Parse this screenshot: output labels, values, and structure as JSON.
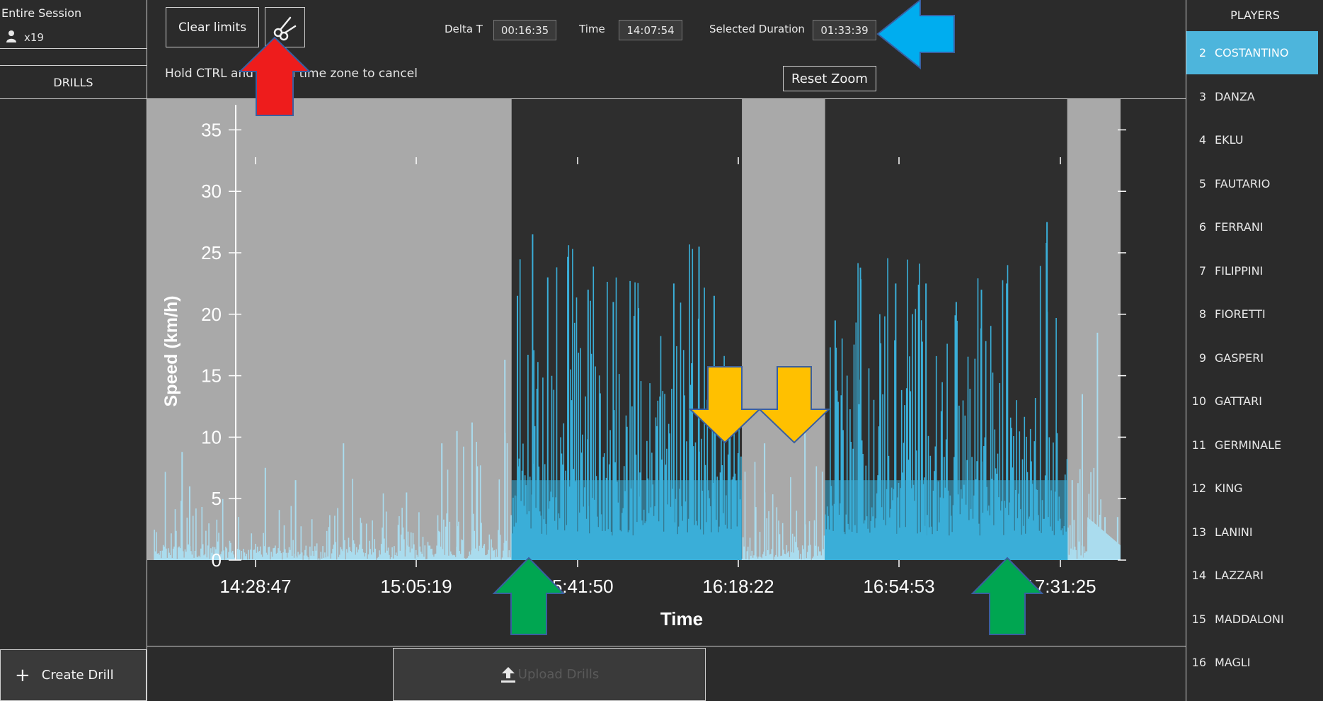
{
  "left_panel": {
    "session_title": "Entire Session",
    "player_count": "x19",
    "drills_header": "DRILLS",
    "create_drill_label": "Create Drill"
  },
  "toolbar": {
    "clear_limits_label": "Clear limits",
    "scissors_icon": "scissors-icon",
    "delta_t_label": "Delta T",
    "delta_t_value": "00:16:35",
    "time_label": "Time",
    "time_value": "14:07:54",
    "selected_duration_label": "Selected Duration",
    "selected_duration_value": "01:33:39",
    "hint": "Hold CTRL and click a time zone to cancel",
    "reset_zoom_label": "Reset Zoom"
  },
  "bottom": {
    "upload_drills_label": "Upload Drills",
    "upload_icon": "upload-icon"
  },
  "players_panel": {
    "header": "PLAYERS",
    "selected_number": "2",
    "items": [
      {
        "number": "2",
        "name": "COSTANTINO"
      },
      {
        "number": "3",
        "name": "DANZA"
      },
      {
        "number": "4",
        "name": "EKLU"
      },
      {
        "number": "5",
        "name": "FAUTARIO"
      },
      {
        "number": "6",
        "name": "FERRANI"
      },
      {
        "number": "7",
        "name": "FILIPPINI"
      },
      {
        "number": "8",
        "name": "FIORETTI"
      },
      {
        "number": "9",
        "name": "GASPERI"
      },
      {
        "number": "10",
        "name": "GATTARI"
      },
      {
        "number": "11",
        "name": "GERMINALE"
      },
      {
        "number": "12",
        "name": "KING"
      },
      {
        "number": "13",
        "name": "LANINI"
      },
      {
        "number": "14",
        "name": "LAZZARI"
      },
      {
        "number": "15",
        "name": "MADDALONI"
      },
      {
        "number": "16",
        "name": "MAGLI"
      }
    ]
  },
  "colors": {
    "background": "#2b2b2b",
    "selected_player": "#4db5dc",
    "zone_inactive": "#a9a9a9",
    "zone_active": "#2e2e2e",
    "speed_active": "#3aaed8",
    "speed_inactive": "#aadcee",
    "arrow_red": "#ee1c1c",
    "arrow_blue": "#00adef",
    "arrow_yellow": "#ffc000",
    "arrow_green": "#00a651"
  },
  "chart_data": {
    "type": "area",
    "xlabel": "Time",
    "ylabel": "Speed (km/h)",
    "ylim": [
      0,
      37.5
    ],
    "yticks": [
      0,
      5,
      10,
      15,
      20,
      25,
      30,
      35
    ],
    "x_time_range": [
      "14:24:35",
      "17:37:35"
    ],
    "xtick_labels": [
      "14:28:47",
      "15:05:19",
      "15:41:50",
      "16:18:22",
      "16:54:53",
      "17:31:25"
    ],
    "selected_zones": [
      {
        "start": "15:36:50",
        "end": "16:22:30"
      },
      {
        "start": "16:39:00",
        "end": "17:27:00"
      }
    ],
    "speed_peaks": [
      {
        "t": "14:31:30",
        "v": 8.8
      },
      {
        "t": "14:33:00",
        "v": 6.0
      },
      {
        "t": "14:48:00",
        "v": 7.5
      },
      {
        "t": "14:54:00",
        "v": 6.5
      },
      {
        "t": "15:03:30",
        "v": 9.5
      },
      {
        "t": "15:16:00",
        "v": 5.5
      },
      {
        "t": "15:23:00",
        "v": 9.5
      },
      {
        "t": "15:26:00",
        "v": 10.5
      },
      {
        "t": "15:29:00",
        "v": 11.2
      },
      {
        "t": "15:35:30",
        "v": 16.3
      },
      {
        "t": "15:38:00",
        "v": 21.5
      },
      {
        "t": "15:41:00",
        "v": 26.5
      },
      {
        "t": "15:44:00",
        "v": 23.0
      },
      {
        "t": "15:48:00",
        "v": 23.5
      },
      {
        "t": "15:52:00",
        "v": 22.0
      },
      {
        "t": "15:57:00",
        "v": 21.0
      },
      {
        "t": "16:02:00",
        "v": 20.5
      },
      {
        "t": "16:09:00",
        "v": 22.5
      },
      {
        "t": "16:14:00",
        "v": 25.5
      },
      {
        "t": "16:17:00",
        "v": 21.5
      },
      {
        "t": "16:20:00",
        "v": 11.5
      },
      {
        "t": "16:27:00",
        "v": 9.5
      },
      {
        "t": "16:35:00",
        "v": 10.5
      },
      {
        "t": "16:41:00",
        "v": 19.5
      },
      {
        "t": "16:46:00",
        "v": 23.8
      },
      {
        "t": "16:53:00",
        "v": 22.5
      },
      {
        "t": "16:59:00",
        "v": 22.5
      },
      {
        "t": "17:05:00",
        "v": 21.0
      },
      {
        "t": "17:10:00",
        "v": 22.0
      },
      {
        "t": "17:15:00",
        "v": 22.5
      },
      {
        "t": "17:23:00",
        "v": 27.5
      },
      {
        "t": "17:28:00",
        "v": 6.5
      },
      {
        "t": "17:30:00",
        "v": 13.5
      },
      {
        "t": "17:33:00",
        "v": 18.5
      },
      {
        "t": "17:34:30",
        "v": 3.5
      },
      {
        "t": "17:37:00",
        "v": 3.5
      }
    ]
  }
}
